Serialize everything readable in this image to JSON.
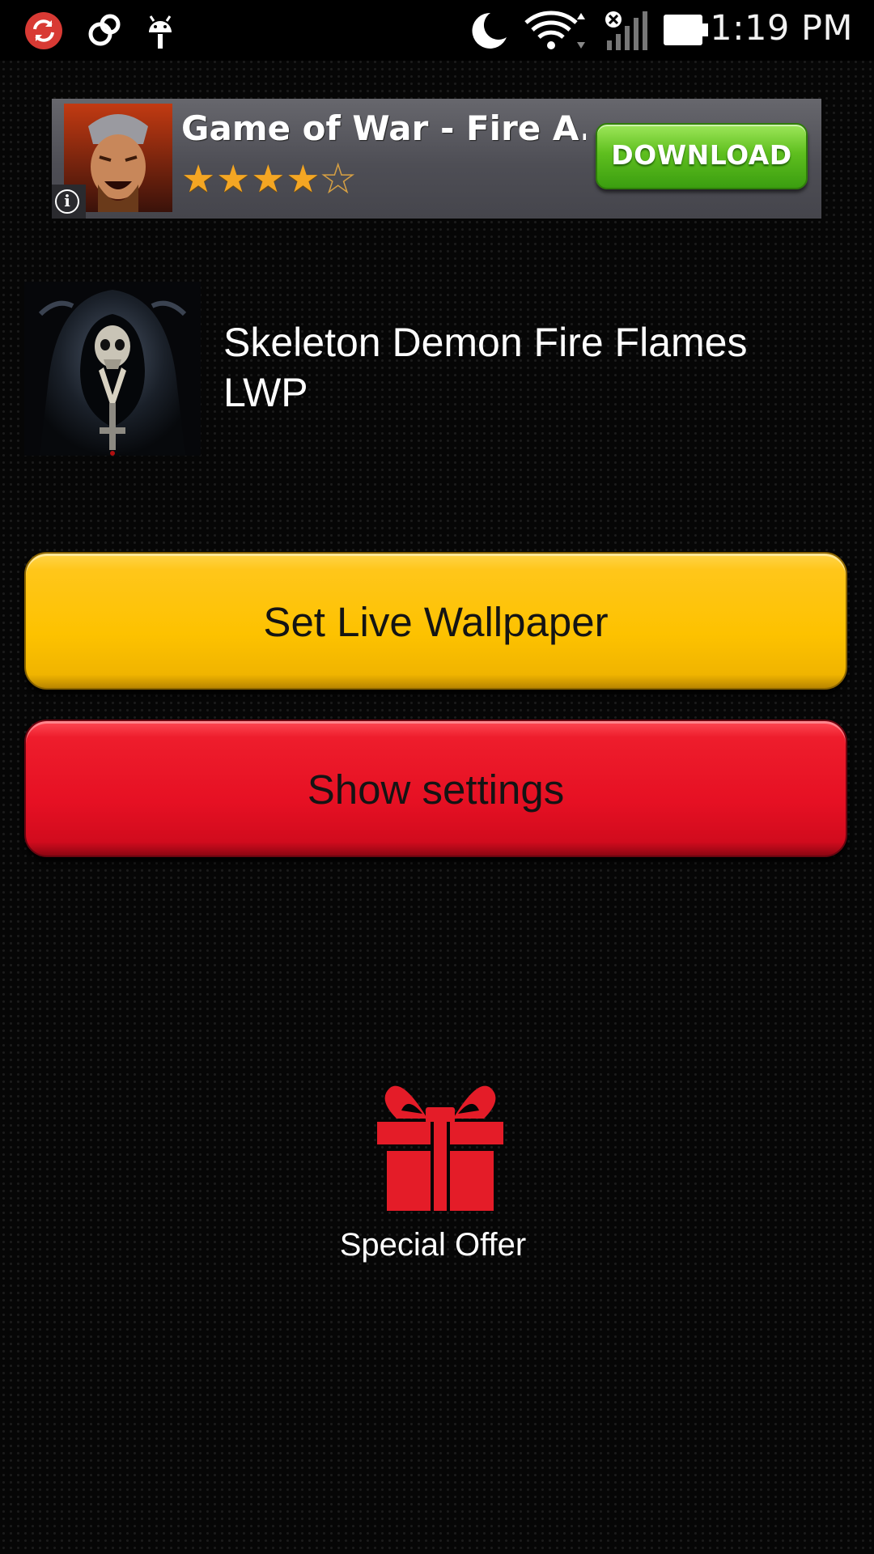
{
  "status_bar": {
    "time": "1:19 PM",
    "icons": [
      "sync-icon",
      "link-icon",
      "android-debug-icon",
      "moon-icon",
      "wifi-icon",
      "no-sim-signal-icon",
      "battery-icon"
    ]
  },
  "ad": {
    "title": "Game of War - Fire A...",
    "rating": 4,
    "rating_max": 5,
    "download_label": "DOWNLOAD",
    "info_label": "i",
    "colors": {
      "download": "#5fbf1f",
      "star": "#f4a623"
    }
  },
  "app": {
    "title": "Skeleton Demon Fire Flames LWP"
  },
  "buttons": {
    "set_wallpaper_label": "Set Live Wallpaper",
    "show_settings_label": "Show settings",
    "colors": {
      "set_wallpaper": "#fdc200",
      "show_settings": "#e61023"
    }
  },
  "offer": {
    "label": "Special Offer",
    "color": "#e41c28"
  }
}
